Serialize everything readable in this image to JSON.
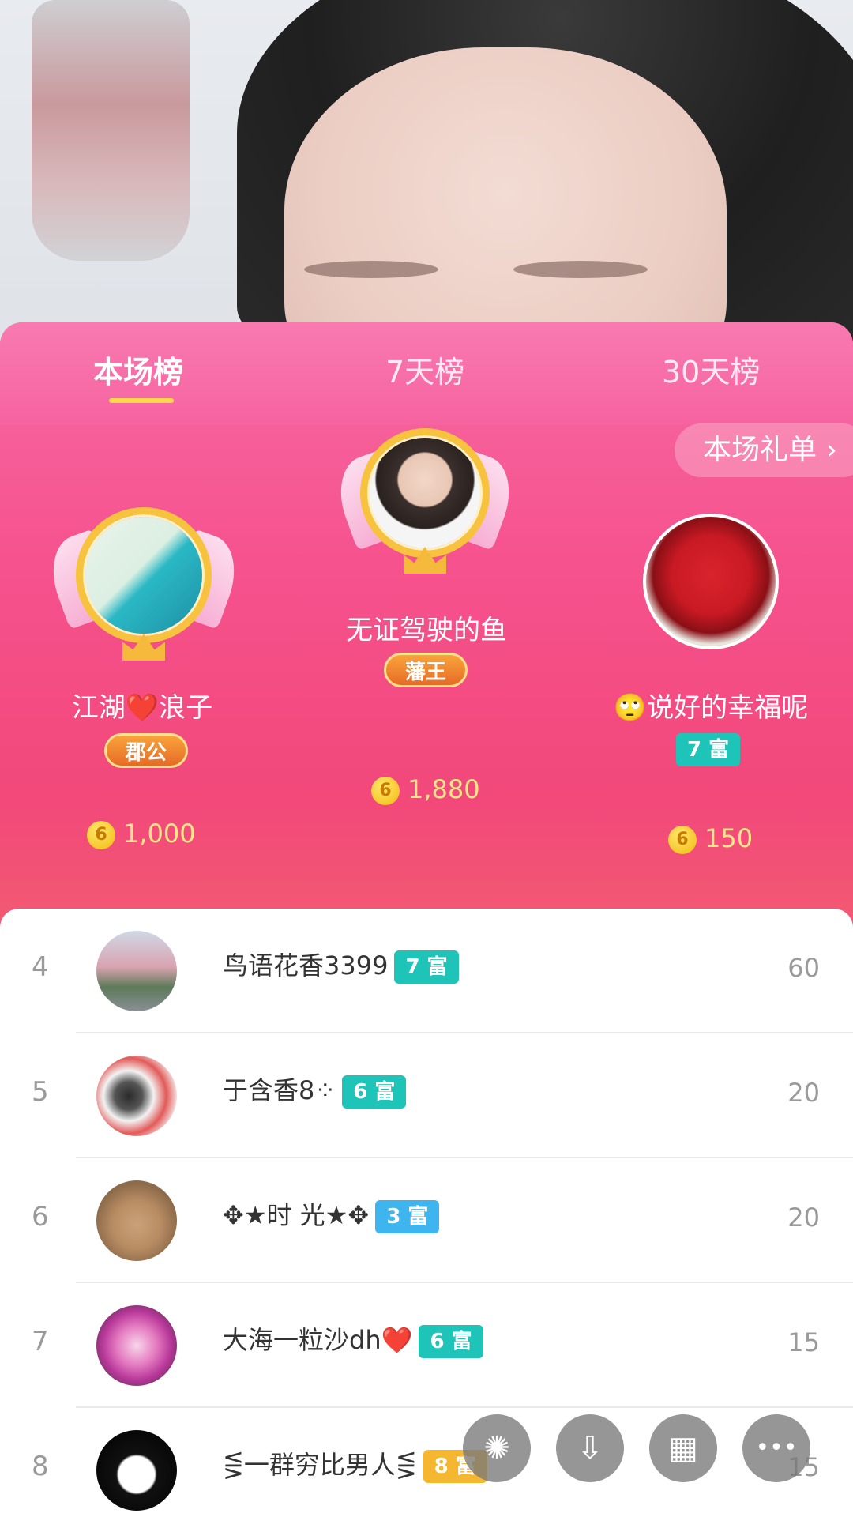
{
  "tabs": [
    {
      "label": "本场榜",
      "active": true
    },
    {
      "label": "7天榜",
      "active": false
    },
    {
      "label": "30天榜",
      "active": false
    }
  ],
  "gift_list_button": "本场礼单",
  "podium": {
    "first": {
      "rank": "1",
      "name": "无证驾驶的鱼",
      "title": "藩王",
      "score": "1,880"
    },
    "second": {
      "rank": "2",
      "name": "江湖❤️浪子",
      "title": "郡公",
      "score": "1,000"
    },
    "third": {
      "rank": "3",
      "name": "🙄说好的幸福呢",
      "rich_level": "7 富",
      "score": "150"
    }
  },
  "coin_glyph": "6",
  "ranking_list": [
    {
      "rank": "4",
      "name": "鸟语花香3399",
      "rich_level": "7 富",
      "score": "60",
      "badge_color": "#1fc4b8"
    },
    {
      "rank": "5",
      "name": "于含香8⁘",
      "rich_level": "6 富",
      "score": "20",
      "badge_color": "#1fc4b8"
    },
    {
      "rank": "6",
      "name": "✥★时 光★✥",
      "rich_level": "3 富",
      "score": "20",
      "badge_color": "#3fb5f0"
    },
    {
      "rank": "7",
      "name": "大海一粒沙dh❤️",
      "rich_level": "6 富",
      "score": "15",
      "badge_color": "#1fc4b8"
    },
    {
      "rank": "8",
      "name": "⋚一群穷比男人⋚",
      "rich_level": "8 富",
      "score": "15",
      "badge_color": "#f5b630"
    }
  ],
  "action_buttons": [
    {
      "icon": "sparkle-icon",
      "glyph": "✺"
    },
    {
      "icon": "download-icon",
      "glyph": "⇩"
    },
    {
      "icon": "grid-icon",
      "glyph": "▦"
    },
    {
      "icon": "more-icon",
      "glyph": "•••"
    }
  ],
  "colors": {
    "panel_pink": "#f6528e",
    "tab_indicator": "#ffd84a",
    "rich_teal": "#1fc4b8",
    "rich_blue": "#3fb5f0",
    "rich_gold": "#f5b630",
    "score_gold": "#ffe58a"
  }
}
